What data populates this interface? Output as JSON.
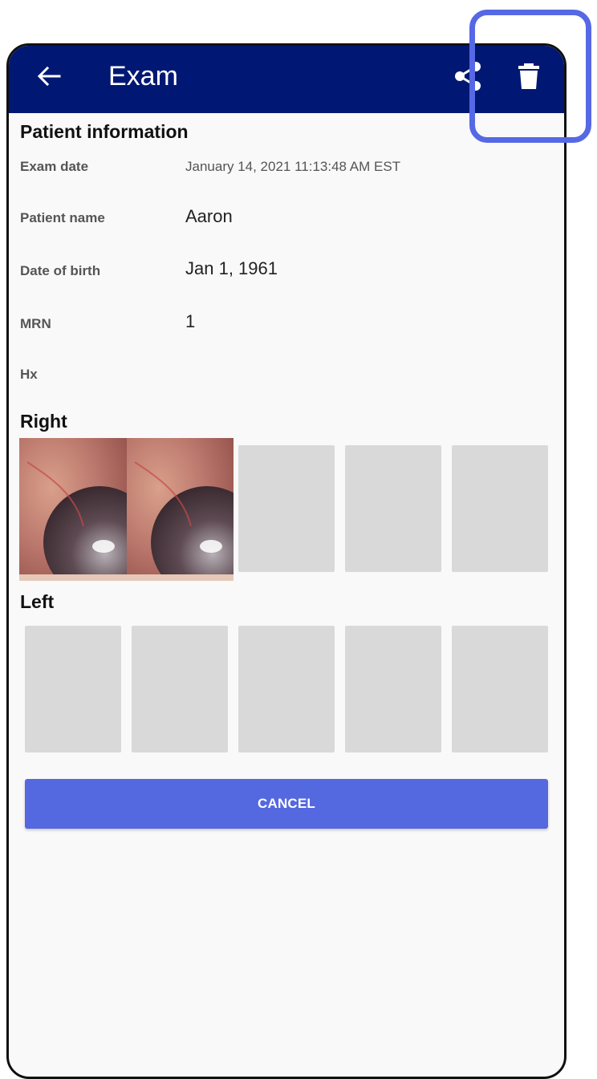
{
  "appbar": {
    "title": "Exam",
    "back_icon": "arrow-left-icon",
    "share_icon": "share-icon",
    "delete_icon": "trash-icon",
    "color": "#001873"
  },
  "patient": {
    "section_title": "Patient information",
    "rows": [
      {
        "label": "Exam date",
        "value": "January 14, 2021 11:13:48 AM EST"
      },
      {
        "label": "Patient name",
        "value": "Aaron"
      },
      {
        "label": "Date of birth",
        "value": "Jan 1, 1961"
      },
      {
        "label": "MRN",
        "value": "1"
      },
      {
        "label": "Hx",
        "value": ""
      }
    ]
  },
  "right": {
    "title": "Right"
  },
  "left": {
    "title": "Left"
  },
  "cancel_label": "CANCEL",
  "accent": "#5468e0"
}
